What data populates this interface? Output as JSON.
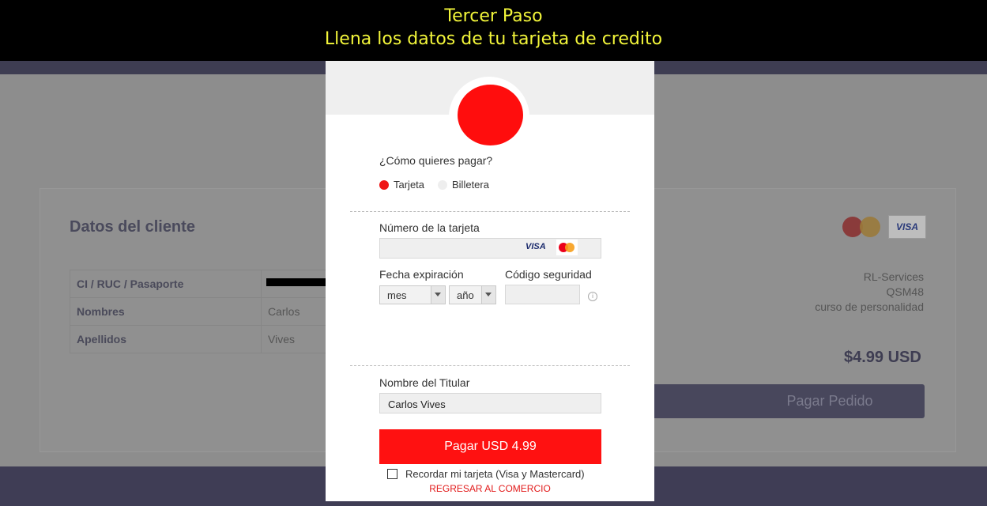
{
  "banner": {
    "line1": "Tercer Paso",
    "line2": "Llena los datos de tu tarjeta de credito"
  },
  "background": {
    "section_title": "Datos del cliente",
    "rows": [
      {
        "label": "CI / RUC / Pasaporte",
        "value": ""
      },
      {
        "label": "Nombres",
        "value": "Carlos"
      },
      {
        "label": "Apellidos",
        "value": "Vives"
      }
    ],
    "merchant": "RL-Services",
    "code": "QSM48",
    "product": "curso de personalidad",
    "price": "$4.99 USD",
    "pay_button": "Pagar Pedido",
    "visa_label": "VISA",
    "mastercard_label": "MasterCard"
  },
  "modal": {
    "question": "¿Cómo quieres pagar?",
    "option_card": "Tarjeta",
    "option_wallet": "Billetera",
    "card_number_label": "Número de la tarjeta",
    "card_number_value": "",
    "visa_badge": "VISA",
    "expiry_label": "Fecha expiración",
    "month_placeholder": "mes",
    "year_placeholder": "año",
    "cvv_label": "Código seguridad",
    "cvv_value": "",
    "holder_label": "Nombre del Titular",
    "holder_value": "Carlos Vives",
    "pay_button": "Pagar USD 4.99",
    "remember_label": "Recordar mi tarjeta (Visa y Mastercard)",
    "back_link": "REGRESAR AL COMERCIO",
    "accent_color": "#ff1111"
  }
}
